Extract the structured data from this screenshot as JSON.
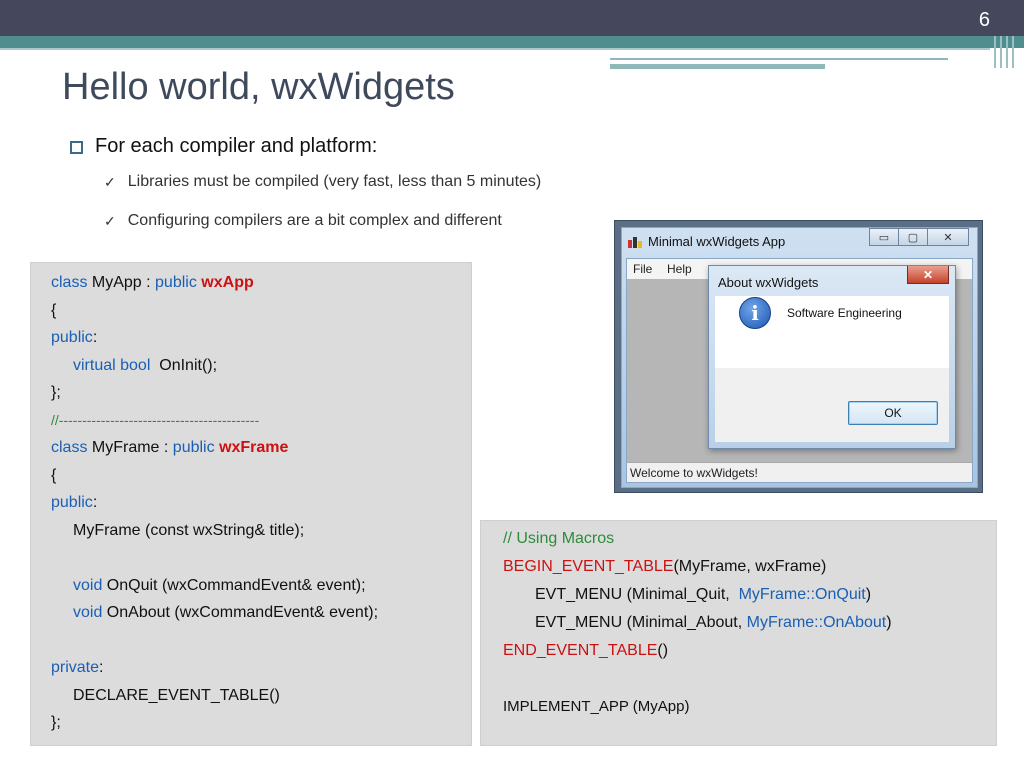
{
  "slide": {
    "number": "6",
    "title": "Hello world, wxWidgets",
    "bullet": "For each compiler and platform:",
    "subbullets": [
      "Libraries must be compiled (very fast, less than 5 minutes)",
      "Configuring compilers are a bit complex and different"
    ]
  },
  "code_left": {
    "l1_kw": "class",
    "l1_name": " MyApp : ",
    "l1_kw2": "public",
    "l1_type": "wxApp",
    "l2": "{",
    "l3_kw": "public",
    "l3_colon": ":",
    "l4_kw": "virtual bool",
    "l4_rest": "  OnInit();",
    "l5": "};",
    "l6": "//-------------------------------------------",
    "l7_kw": "class",
    "l7_name": " MyFrame : ",
    "l7_kw2": "public",
    "l7_type": "wxFrame",
    "l8": "{",
    "l9_kw": "public",
    "l9_colon": ":",
    "l10": "MyFrame (const wxString& title);",
    "l12_kw": "void",
    "l12_rest": " OnQuit (wxCommandEvent& event);",
    "l13_kw": "void",
    "l13_rest": " OnAbout (wxCommandEvent& event);",
    "l15_kw": "private",
    "l15_colon": ":",
    "l16": "DECLARE_EVENT_TABLE()",
    "l17": "};"
  },
  "code_right": {
    "r1": "// Using Macros",
    "r2_mac": "BEGIN_EVENT_TABLE",
    "r2_rest": "(MyFrame, wxFrame)",
    "r3_a": "EVT_MENU (Minimal_Quit,  ",
    "r3_b": "MyFrame::OnQuit",
    "r3_c": ")",
    "r4_a": "EVT_MENU (Minimal_About, ",
    "r4_b": "MyFrame::OnAbout",
    "r4_c": ")",
    "r5_mac": "END_EVENT_TABLE",
    "r5_rest": "()",
    "r7": "IMPLEMENT_APP (MyApp)"
  },
  "window": {
    "title": "Minimal wxWidgets App",
    "menu": [
      "File",
      "Help"
    ],
    "status": "Welcome to wxWidgets!",
    "minimize_glyph": "▭",
    "maximize_glyph": "▢",
    "close_glyph": "✕"
  },
  "dialog": {
    "title": "About wxWidgets",
    "close_glyph": "✕",
    "icon_glyph": "i",
    "message": "Software Engineering",
    "ok_label": "OK"
  },
  "colors": {
    "topbar": "#45485c",
    "teal": "#4f8d8e",
    "keyword": "#1a5fb4",
    "type": "#cc1111",
    "comment": "#2e8b3c"
  }
}
